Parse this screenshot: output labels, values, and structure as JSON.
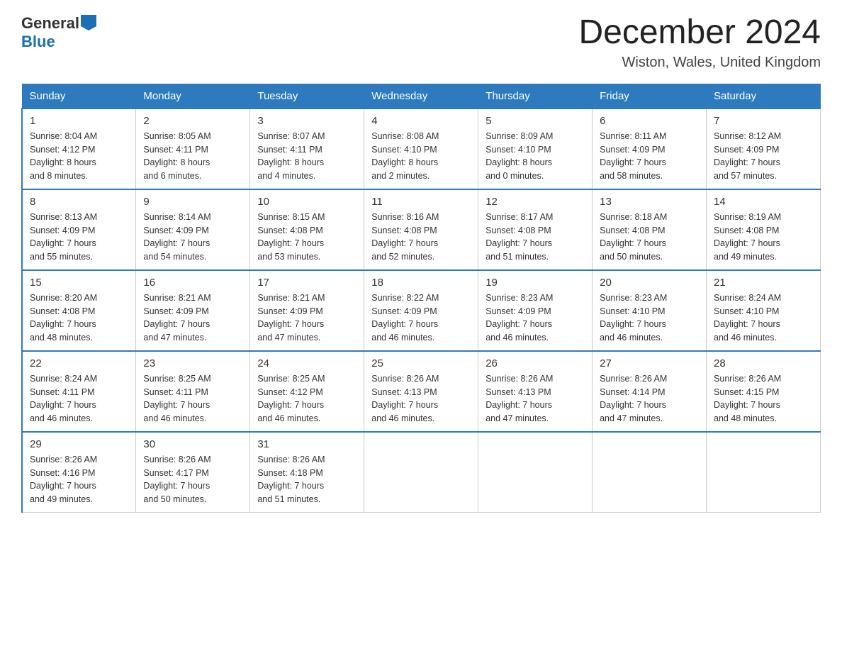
{
  "header": {
    "logo_general": "General",
    "logo_blue": "Blue",
    "title": "December 2024",
    "subtitle": "Wiston, Wales, United Kingdom"
  },
  "columns": [
    "Sunday",
    "Monday",
    "Tuesday",
    "Wednesday",
    "Thursday",
    "Friday",
    "Saturday"
  ],
  "weeks": [
    [
      {
        "day": "1",
        "sunrise": "8:04 AM",
        "sunset": "4:12 PM",
        "daylight": "8 hours and 8 minutes."
      },
      {
        "day": "2",
        "sunrise": "8:05 AM",
        "sunset": "4:11 PM",
        "daylight": "8 hours and 6 minutes."
      },
      {
        "day": "3",
        "sunrise": "8:07 AM",
        "sunset": "4:11 PM",
        "daylight": "8 hours and 4 minutes."
      },
      {
        "day": "4",
        "sunrise": "8:08 AM",
        "sunset": "4:10 PM",
        "daylight": "8 hours and 2 minutes."
      },
      {
        "day": "5",
        "sunrise": "8:09 AM",
        "sunset": "4:10 PM",
        "daylight": "8 hours and 0 minutes."
      },
      {
        "day": "6",
        "sunrise": "8:11 AM",
        "sunset": "4:09 PM",
        "daylight": "7 hours and 58 minutes."
      },
      {
        "day": "7",
        "sunrise": "8:12 AM",
        "sunset": "4:09 PM",
        "daylight": "7 hours and 57 minutes."
      }
    ],
    [
      {
        "day": "8",
        "sunrise": "8:13 AM",
        "sunset": "4:09 PM",
        "daylight": "7 hours and 55 minutes."
      },
      {
        "day": "9",
        "sunrise": "8:14 AM",
        "sunset": "4:09 PM",
        "daylight": "7 hours and 54 minutes."
      },
      {
        "day": "10",
        "sunrise": "8:15 AM",
        "sunset": "4:08 PM",
        "daylight": "7 hours and 53 minutes."
      },
      {
        "day": "11",
        "sunrise": "8:16 AM",
        "sunset": "4:08 PM",
        "daylight": "7 hours and 52 minutes."
      },
      {
        "day": "12",
        "sunrise": "8:17 AM",
        "sunset": "4:08 PM",
        "daylight": "7 hours and 51 minutes."
      },
      {
        "day": "13",
        "sunrise": "8:18 AM",
        "sunset": "4:08 PM",
        "daylight": "7 hours and 50 minutes."
      },
      {
        "day": "14",
        "sunrise": "8:19 AM",
        "sunset": "4:08 PM",
        "daylight": "7 hours and 49 minutes."
      }
    ],
    [
      {
        "day": "15",
        "sunrise": "8:20 AM",
        "sunset": "4:08 PM",
        "daylight": "7 hours and 48 minutes."
      },
      {
        "day": "16",
        "sunrise": "8:21 AM",
        "sunset": "4:09 PM",
        "daylight": "7 hours and 47 minutes."
      },
      {
        "day": "17",
        "sunrise": "8:21 AM",
        "sunset": "4:09 PM",
        "daylight": "7 hours and 47 minutes."
      },
      {
        "day": "18",
        "sunrise": "8:22 AM",
        "sunset": "4:09 PM",
        "daylight": "7 hours and 46 minutes."
      },
      {
        "day": "19",
        "sunrise": "8:23 AM",
        "sunset": "4:09 PM",
        "daylight": "7 hours and 46 minutes."
      },
      {
        "day": "20",
        "sunrise": "8:23 AM",
        "sunset": "4:10 PM",
        "daylight": "7 hours and 46 minutes."
      },
      {
        "day": "21",
        "sunrise": "8:24 AM",
        "sunset": "4:10 PM",
        "daylight": "7 hours and 46 minutes."
      }
    ],
    [
      {
        "day": "22",
        "sunrise": "8:24 AM",
        "sunset": "4:11 PM",
        "daylight": "7 hours and 46 minutes."
      },
      {
        "day": "23",
        "sunrise": "8:25 AM",
        "sunset": "4:11 PM",
        "daylight": "7 hours and 46 minutes."
      },
      {
        "day": "24",
        "sunrise": "8:25 AM",
        "sunset": "4:12 PM",
        "daylight": "7 hours and 46 minutes."
      },
      {
        "day": "25",
        "sunrise": "8:26 AM",
        "sunset": "4:13 PM",
        "daylight": "7 hours and 46 minutes."
      },
      {
        "day": "26",
        "sunrise": "8:26 AM",
        "sunset": "4:13 PM",
        "daylight": "7 hours and 47 minutes."
      },
      {
        "day": "27",
        "sunrise": "8:26 AM",
        "sunset": "4:14 PM",
        "daylight": "7 hours and 47 minutes."
      },
      {
        "day": "28",
        "sunrise": "8:26 AM",
        "sunset": "4:15 PM",
        "daylight": "7 hours and 48 minutes."
      }
    ],
    [
      {
        "day": "29",
        "sunrise": "8:26 AM",
        "sunset": "4:16 PM",
        "daylight": "7 hours and 49 minutes."
      },
      {
        "day": "30",
        "sunrise": "8:26 AM",
        "sunset": "4:17 PM",
        "daylight": "7 hours and 50 minutes."
      },
      {
        "day": "31",
        "sunrise": "8:26 AM",
        "sunset": "4:18 PM",
        "daylight": "7 hours and 51 minutes."
      },
      null,
      null,
      null,
      null
    ]
  ],
  "labels": {
    "sunrise": "Sunrise:",
    "sunset": "Sunset:",
    "daylight": "Daylight:"
  }
}
